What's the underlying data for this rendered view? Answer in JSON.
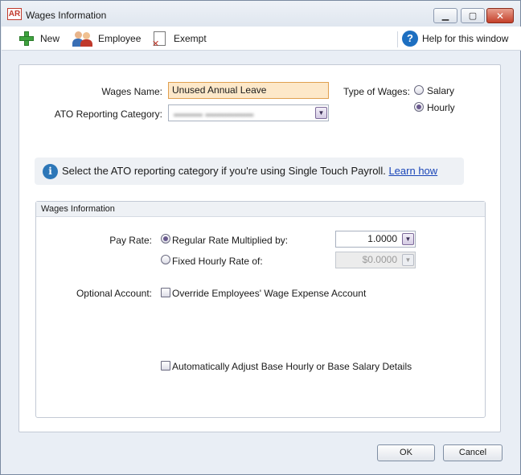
{
  "window": {
    "app_badge": "AR",
    "title": "Wages Information"
  },
  "toolbar": {
    "new_label": "New",
    "employee_label": "Employee",
    "exempt_label": "Exempt",
    "help_label": "Help for this window"
  },
  "form": {
    "wages_name_label": "Wages Name:",
    "wages_name_value": "Unused Annual Leave",
    "ato_category_label": "ATO Reporting Category:",
    "ato_category_value": "",
    "type_of_wages_label": "Type of Wages:",
    "type_options": [
      {
        "label": "Salary",
        "selected": false
      },
      {
        "label": "Hourly",
        "selected": true
      }
    ]
  },
  "info": {
    "message": "Select the ATO reporting category if you're using Single Touch Payroll.",
    "link": "Learn how"
  },
  "wages_info": {
    "heading": "Wages Information",
    "pay_rate_label": "Pay Rate:",
    "regular_rate_label": "Regular Rate Multiplied by:",
    "regular_rate_value": "1.0000",
    "regular_rate_selected": true,
    "fixed_rate_label": "Fixed Hourly Rate of:",
    "fixed_rate_value": "$0.0000",
    "fixed_rate_selected": false,
    "optional_account_label": "Optional Account:",
    "override_label": "Override Employees' Wage Expense Account",
    "auto_adjust_label": "Automatically Adjust Base Hourly or Base Salary Details"
  },
  "buttons": {
    "ok": "OK",
    "cancel": "Cancel"
  }
}
